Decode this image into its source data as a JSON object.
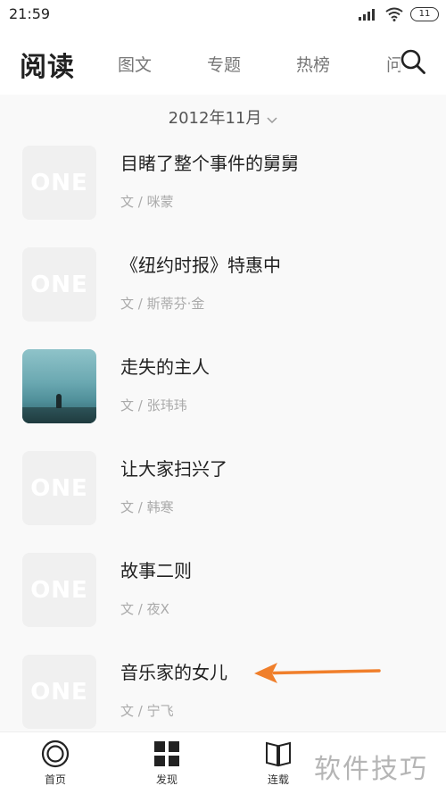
{
  "status_bar": {
    "time": "21:59",
    "battery": "11"
  },
  "header": {
    "title": "阅读",
    "tabs": [
      "图文",
      "专题",
      "热榜"
    ],
    "partial_tab": "问"
  },
  "month_selector": {
    "label": "2012年11月"
  },
  "articles": [
    {
      "title": "目睹了整个事件的舅舅",
      "author": "文 / 咪蒙",
      "thumb": "ONE"
    },
    {
      "title": "《纽约时报》特惠中",
      "author": "文 / 斯蒂芬·金",
      "thumb": "ONE"
    },
    {
      "title": "走失的主人",
      "author": "文 / 张玮玮",
      "thumb": ""
    },
    {
      "title": "让大家扫兴了",
      "author": "文 / 韩寒",
      "thumb": "ONE"
    },
    {
      "title": "故事二则",
      "author": "文 / 夜X",
      "thumb": "ONE"
    },
    {
      "title": "音乐家的女儿",
      "author": "文 / 宁飞",
      "thumb": "ONE"
    }
  ],
  "bottom_nav": [
    {
      "label": "首页",
      "icon": "home-ring-icon"
    },
    {
      "label": "发现",
      "icon": "grid-icon"
    },
    {
      "label": "连载",
      "icon": "book-icon"
    }
  ],
  "watermark": "软件技巧",
  "colors": {
    "annotation_arrow": "#f07f2b",
    "thumb_bg": "#f0f0f0",
    "content_bg": "#f9f9f9"
  }
}
